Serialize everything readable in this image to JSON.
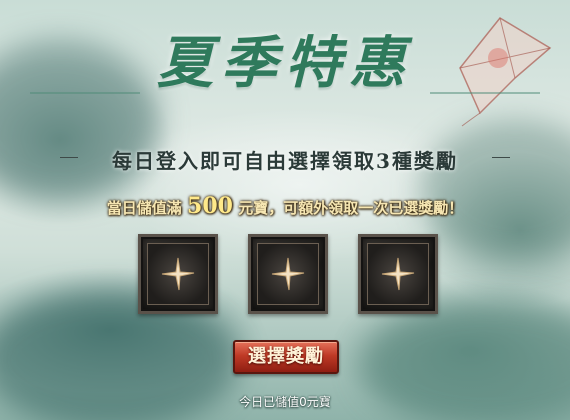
{
  "title": "夏季特惠",
  "subtitle": "每日登入即可自由選擇領取3種獎勵",
  "notice": {
    "prefix": "當日儲值滿",
    "amount": "500",
    "suffix": "元寶，可額外領取一次已選獎勵！"
  },
  "reward_slots": [
    {
      "icon": "plus-icon"
    },
    {
      "icon": "plus-icon"
    },
    {
      "icon": "plus-icon"
    }
  ],
  "select_button_label": "選擇獎勵",
  "stored_text": "今日已儲值0元寶",
  "colors": {
    "title": "#2f7a5c",
    "button": "#bf3a26",
    "notice_amount": "#ffe98a"
  }
}
